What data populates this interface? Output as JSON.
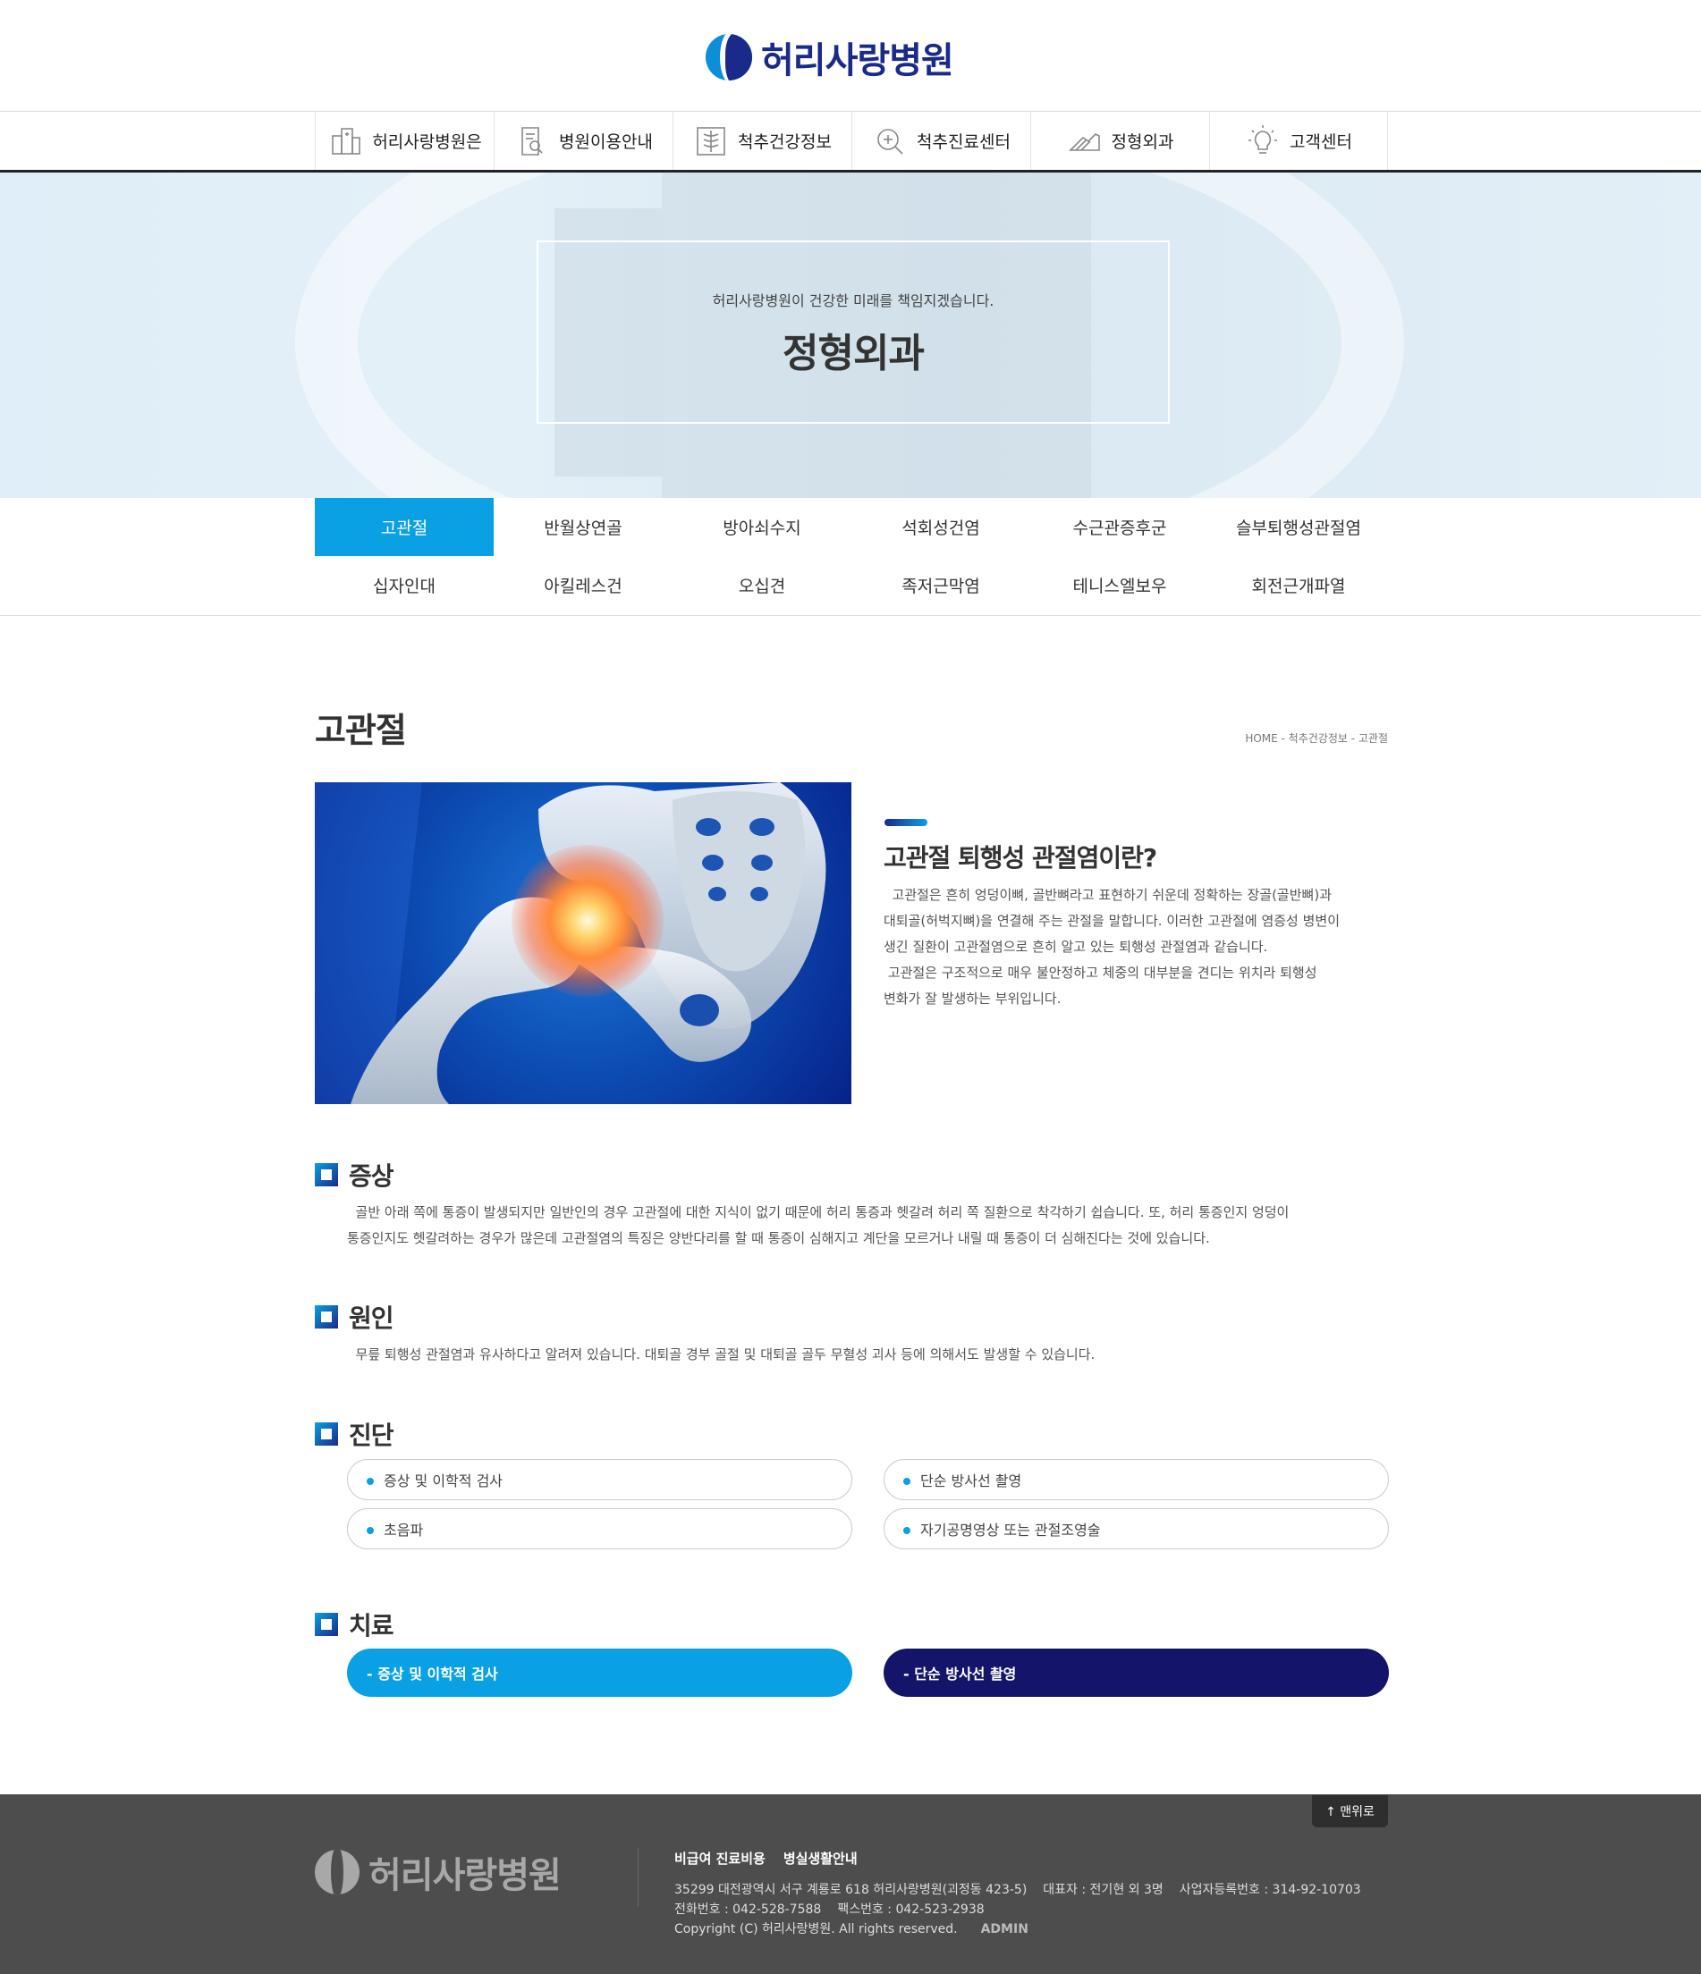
{
  "header": {
    "logo_text": "허리사랑병원"
  },
  "gnb": [
    {
      "label": "허리사랑병원은",
      "icon": "hospital-building-icon"
    },
    {
      "label": "병원이용안내",
      "icon": "document-search-icon"
    },
    {
      "label": "척추건강정보",
      "icon": "spine-xray-icon"
    },
    {
      "label": "척추진료센터",
      "icon": "magnifier-plus-icon"
    },
    {
      "label": "정형외과",
      "icon": "foot-icon"
    },
    {
      "label": "고객센터",
      "icon": "lightbulb-icon"
    }
  ],
  "visual": {
    "subtitle": "허리사랑병원이 건강한 미래를 책임지겠습니다.",
    "title": "정형외과"
  },
  "subnav": [
    {
      "label": "고관절",
      "active": true
    },
    {
      "label": "반월상연골"
    },
    {
      "label": "방아쇠수지"
    },
    {
      "label": "석회성건염"
    },
    {
      "label": "수근관증후군"
    },
    {
      "label": "슬부퇴행성관절염"
    },
    {
      "label": "십자인대"
    },
    {
      "label": "아킬레스건"
    },
    {
      "label": "오십견"
    },
    {
      "label": "족저근막염"
    },
    {
      "label": "테니스엘보우"
    },
    {
      "label": "회전근개파열"
    }
  ],
  "page": {
    "title": "고관절",
    "breadcrumb": "HOME - 척추건강정보 - 고관절"
  },
  "intro": {
    "title": "고관절 퇴행성 관절염이란?",
    "lines": [
      "  고관절은 흔히 엉덩이뼈, 골반뼈라고 표현하기 쉬운데 정확하는 장골(골반뼈)과",
      "대퇴골(허벅지뼈)을 연결해 주는 관절을 말합니다. 이러한 고관절에 염증성 병변이",
      "생긴 질환이 고관절염으로 흔히 알고 있는 퇴행성 관절염과 같습니다.",
      " 고관절은 구조적으로 매우 불안정하고 체중의 대부분을 견디는 위치라 퇴행성",
      "변화가 잘 발생하는 부위입니다."
    ]
  },
  "sections": {
    "symptom": {
      "title": "증상",
      "lines": [
        "  골반 아래 쪽에 통증이 발생되지만 일반인의 경우 고관절에 대한 지식이 없기 때문에 허리 통증과 헷갈려 허리 쪽 질환으로 착각하기 쉽습니다. 또, 허리 통증인지 엉덩이",
        "통증인지도 헷갈려하는 경우가 많은데 고관절염의 특징은 양반다리를 할 때 통증이 심해지고 계단을 모르거나 내릴 때 통증이 더 심해진다는 것에 있습니다."
      ]
    },
    "cause": {
      "title": "원인",
      "text": "  무릎 퇴행성 관절염과 유사하다고 알려져 있습니다. 대퇴골 경부 골절 및 대퇴골 골두 무혈성 괴사 등에 의해서도 발생할 수 있습니다."
    },
    "diagnosis": {
      "title": "진단",
      "items": [
        "증상 및 이학적 검사",
        "단순 방사선 촬영",
        "초음파",
        "자기공명영상 또는 관절조영술"
      ]
    },
    "treatment": {
      "title": "치료",
      "buttons": [
        "- 증상 및 이학적 검사",
        "- 단순 방사선 촬영"
      ]
    }
  },
  "footer": {
    "top_button": "↑ 맨위로",
    "logo_text": "허리사랑병원",
    "links": [
      "비급여 진료비용",
      "병실생활안내"
    ],
    "address": "35299 대전광역시 서구 계룡로 618 허리사랑병원(괴정동 423-5)",
    "ceo": "대표자 : 전기현 외 3명",
    "biz_no": "사업자등록번호 : 314-92-10703",
    "phone": "전화번호 : 042-528-7588",
    "fax": "팩스번호 : 042-523-2938",
    "copyright": "Copyright (C) 허리사랑병원. All rights reserved.",
    "admin": "ADMIN"
  },
  "colors": {
    "brand_navy": "#1a2a8a",
    "accent_blue": "#0aa0e4",
    "treatment_navy": "#14146a",
    "footer_bg": "#4d4d4d"
  }
}
